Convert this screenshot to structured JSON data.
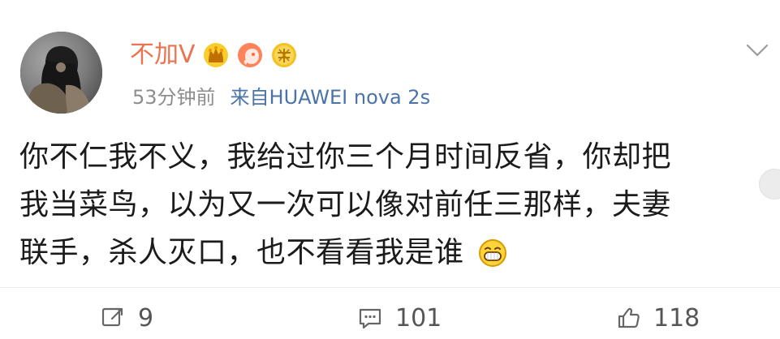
{
  "post": {
    "username": "不加V",
    "time": "53分钟前",
    "source": "来自HUAWEI nova 2s",
    "content_lines": [
      "你不仁我不义，我给过你三个月时间反省，你却把",
      "我当菜鸟，以为又一次可以像对前任三那样，夫妻",
      "联手，杀人灭口，也不看看我是谁"
    ],
    "inline_emoji": "grin-emoji"
  },
  "badges": [
    {
      "icon": "crown-icon",
      "color": "#f0b400"
    },
    {
      "icon": "member-icon",
      "color": "#ff6a3d"
    },
    {
      "icon": "veteran-badge",
      "color": "#f1a600"
    }
  ],
  "actions": {
    "repost_count": "9",
    "comment_count": "101",
    "like_count": "118"
  },
  "icons": {
    "more": "chevron-down-icon",
    "repost": "repost-icon",
    "comment": "comment-icon",
    "like": "thumbs-up-icon"
  }
}
